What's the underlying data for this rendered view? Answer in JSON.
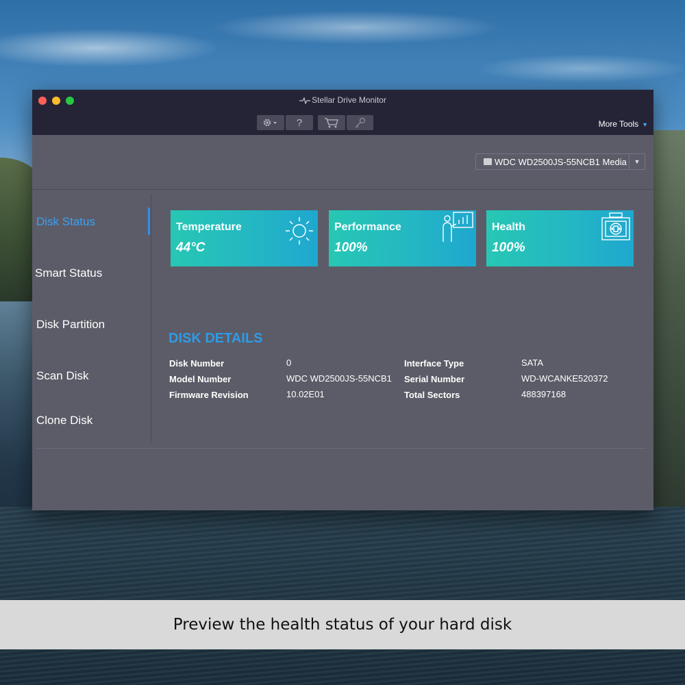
{
  "window": {
    "title": "Stellar Drive Monitor"
  },
  "toolbar": {
    "settings_icon": "gear-icon",
    "help_label": "?",
    "cart_icon": "cart-icon",
    "key_icon": "key-icon",
    "more_tools": "More Tools"
  },
  "drive": {
    "selected": "WDC WD2500JS-55NCB1 Media"
  },
  "sidebar": {
    "items": [
      {
        "label": "Disk Status",
        "active": true
      },
      {
        "label": "Smart Status"
      },
      {
        "label": "Disk Partition"
      },
      {
        "label": "Scan Disk"
      },
      {
        "label": "Clone Disk"
      }
    ]
  },
  "cards": [
    {
      "title": "Temperature",
      "value": "44°C",
      "icon": "sun-icon"
    },
    {
      "title": "Performance",
      "value": "100%",
      "icon": "presentation-icon"
    },
    {
      "title": "Health",
      "value": "100%",
      "icon": "first-aid-icon"
    }
  ],
  "details": {
    "heading": "DISK DETAILS",
    "rows": [
      {
        "label": "Disk Number",
        "value": "0",
        "label2": "Interface Type",
        "value2": "SATA"
      },
      {
        "label": "Model Number",
        "value": "WDC WD2500JS-55NCB1",
        "label2": "Serial Number",
        "value2": "WD-WCANKE520372"
      },
      {
        "label": "Firmware Revision",
        "value": "10.02E01",
        "label2": "Total Sectors",
        "value2": "488397168"
      }
    ]
  },
  "caption": "Preview the health status of your hard disk",
  "colors": {
    "accent": "#2e9be6",
    "card_start": "#27c7b4",
    "card_end": "#1fa7cf",
    "titlebar": "#252437",
    "window": "#5c5c68"
  }
}
